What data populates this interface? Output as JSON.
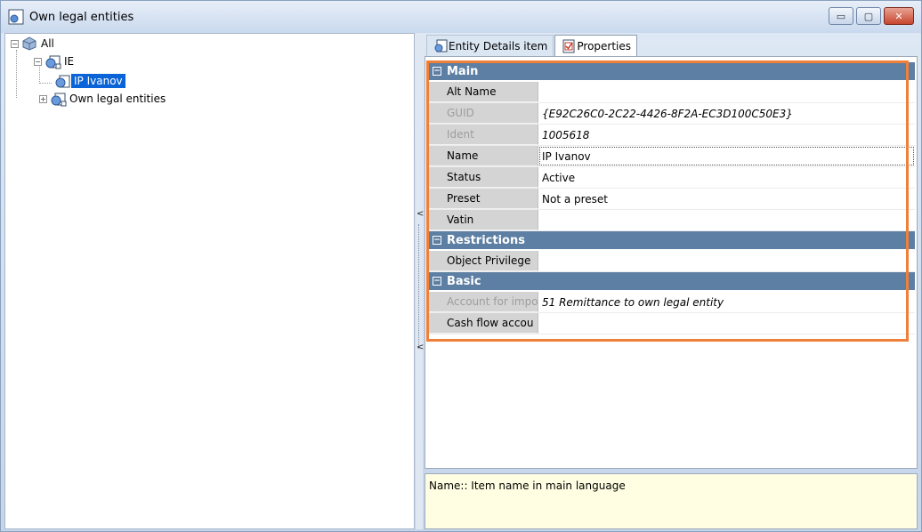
{
  "window": {
    "title": "Own legal entities",
    "buttons": {
      "minimize": "▭",
      "maximize": "▢",
      "close": "✕"
    }
  },
  "tree": {
    "nodes": [
      {
        "label": "All",
        "expander": "−",
        "icon": "globe-icon"
      },
      {
        "label": "IE",
        "expander": "−",
        "icon": "entity-folder-icon"
      },
      {
        "label": "IP Ivanov",
        "icon": "entity-item-icon",
        "selected": true
      },
      {
        "label": "Own legal entities",
        "expander": "+",
        "icon": "entity-folder-icon"
      }
    ]
  },
  "splitter": {
    "arrow_top": "<",
    "arrow_bottom": "<"
  },
  "tabs": [
    {
      "label": "Entity Details item",
      "icon": "entity-icon",
      "active": false
    },
    {
      "label": "Properties",
      "icon": "properties-icon",
      "active": true
    }
  ],
  "properties": {
    "collapse_glyph": "−",
    "categories": [
      {
        "name": "Main",
        "rows": [
          {
            "name": "Alt Name",
            "value": ""
          },
          {
            "name": "GUID",
            "value": "{E92C26C0-2C22-4426-8F2A-EC3D100C50E3}",
            "readonly": true
          },
          {
            "name": "Ident",
            "value": "1005618",
            "readonly": true
          },
          {
            "name": "Name",
            "value": "IP Ivanov",
            "focused": true
          },
          {
            "name": "Status",
            "value": "Active"
          },
          {
            "name": "Preset",
            "value": "Not a preset"
          },
          {
            "name": "Vatin",
            "value": ""
          }
        ]
      },
      {
        "name": "Restrictions",
        "rows": [
          {
            "name": "Object Privilege",
            "value": ""
          }
        ]
      },
      {
        "name": "Basic",
        "rows": [
          {
            "name": "Account for impo",
            "value": "51 Remittance to own legal entity",
            "readonly": true
          },
          {
            "name": "Cash flow accou",
            "value": ""
          }
        ]
      }
    ]
  },
  "description": {
    "text": "Name:: Item name in main language"
  },
  "colors": {
    "category_header": "#5d7fa3",
    "selection": "#0a64d8",
    "highlight_outline": "#f07f3a",
    "description_bg": "#fffee2"
  }
}
